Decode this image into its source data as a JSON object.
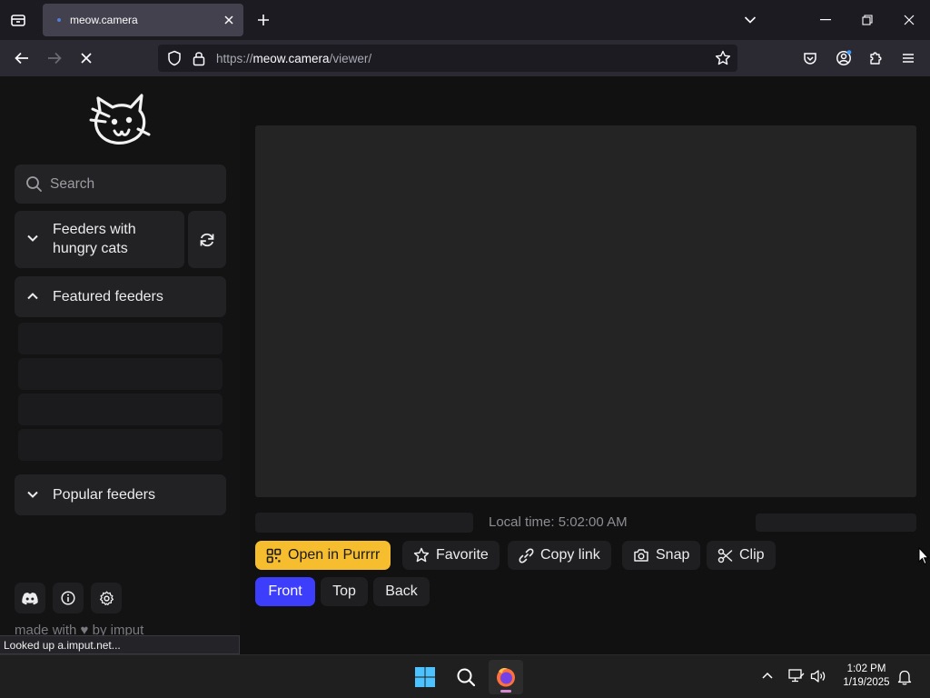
{
  "browser": {
    "tab_title": "meow.camera",
    "url_prefix": "https://",
    "url_domain": "meow.camera",
    "url_path": "/viewer/",
    "status_text": "Looked up a.imput.net..."
  },
  "sidebar": {
    "search_placeholder": "Search",
    "sections": {
      "hungry": "Feeders with hungry cats",
      "featured": "Featured feeders",
      "popular": "Popular feeders"
    },
    "footer_text": "made with ♥ by imput"
  },
  "viewer": {
    "local_time": "Local time: 5:02:00 AM",
    "actions": {
      "open": "Open in Purrrr",
      "favorite": "Favorite",
      "copy": "Copy link",
      "snap": "Snap",
      "clip": "Clip"
    },
    "views": {
      "front": "Front",
      "top": "Top",
      "back": "Back"
    }
  },
  "taskbar": {
    "time": "1:02 PM",
    "date": "1/19/2025"
  },
  "colors": {
    "accent_yellow": "#f6be2f",
    "accent_blue": "#3d3dfc"
  }
}
